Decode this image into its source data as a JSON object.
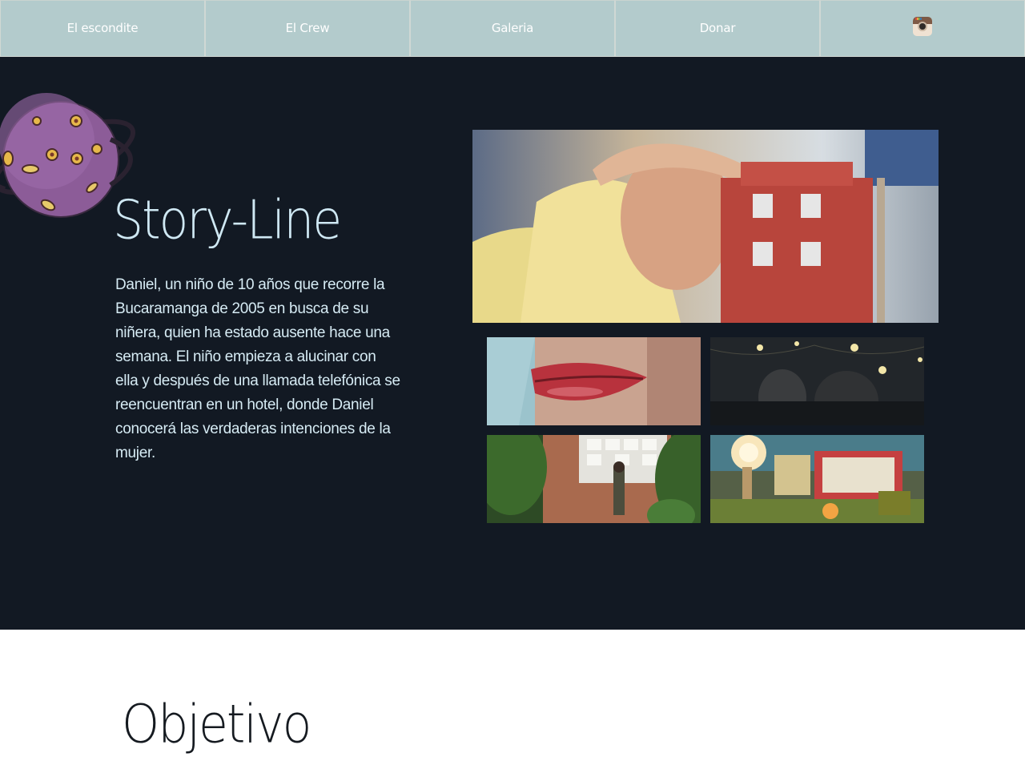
{
  "nav": {
    "items": [
      {
        "label": "El escondite"
      },
      {
        "label": "El Crew"
      },
      {
        "label": "Galeria"
      },
      {
        "label": "Donar"
      }
    ],
    "instagram_icon": "instagram-icon"
  },
  "story": {
    "title": "Story-Line",
    "text": "Daniel, un niño de 10 años que recorre la Bucaramanga de 2005 en busca de su niñera, quien ha estado ausente hace una semana. El niño empieza a alucinar con ella y después de una llamada telefónica se reencuentran en un hotel, donde Daniel conocerá las verdaderas intenciones de la mujer."
  },
  "objetivo": {
    "title": "Objetivo"
  },
  "colors": {
    "nav_bg": "#b3cbcc",
    "story_bg": "#121923",
    "title_color": "#cfe8f3",
    "body_bg": "#ffffff"
  }
}
